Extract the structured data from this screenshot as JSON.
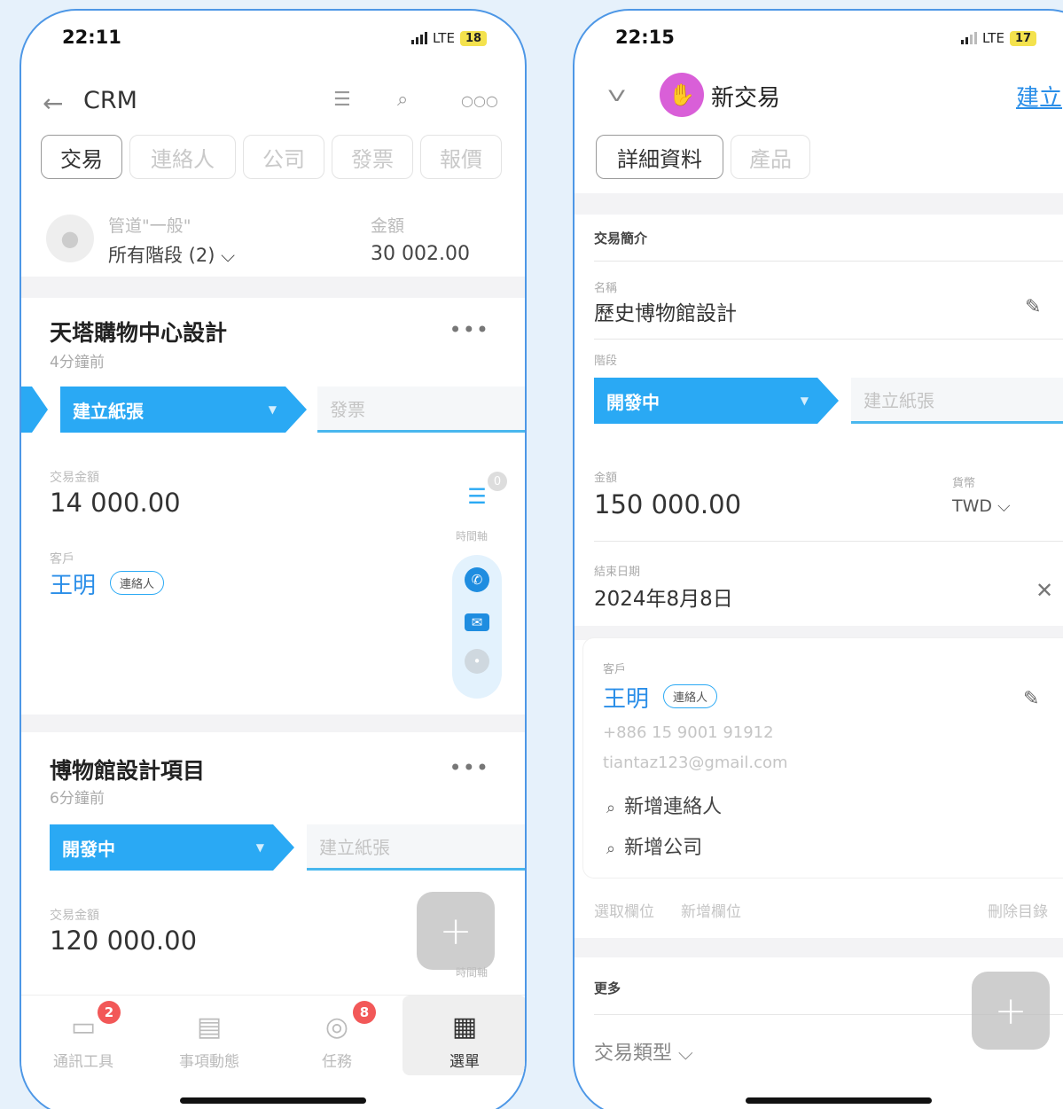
{
  "left_phone": {
    "status": {
      "time": "22:11",
      "network": "LTE",
      "battery": "18"
    },
    "header": {
      "title": "CRM"
    },
    "tabs": [
      "交易",
      "連絡人",
      "公司",
      "發票",
      "報價"
    ],
    "pipeline": {
      "label": "管道\"一般\"",
      "stage_selector": "所有階段 (2) ⌵",
      "amount_label": "金額",
      "amount_value": "30 002.00"
    },
    "deals": [
      {
        "title": "天塔購物中心設計",
        "time": "4分鐘前",
        "stage": "建立紙張",
        "next_stage": "發票",
        "amount_label": "交易金額",
        "amount": "14 000.00",
        "client_label": "客戶",
        "client_name": "王明",
        "client_badge": "連絡人"
      },
      {
        "title": "博物館設計項目",
        "time": "6分鐘前",
        "stage": "開發中",
        "next_stage": "建立紙張",
        "amount_label": "交易金額",
        "amount": "120 000.00"
      }
    ],
    "side_panel": {
      "timeline_label": "時間軸",
      "timeline_count": "0",
      "timeline_label_2": "時間軸"
    },
    "bottom_nav": [
      {
        "label": "通訊工具",
        "badge": "2",
        "icon": "chat-icon"
      },
      {
        "label": "事項動態",
        "badge": "",
        "icon": "feed-icon"
      },
      {
        "label": "任務",
        "badge": "8",
        "icon": "task-check-icon"
      },
      {
        "label": "選單",
        "badge": "",
        "icon": "grid-menu-icon"
      }
    ]
  },
  "right_phone": {
    "status": {
      "time": "22:15",
      "network": "LTE",
      "battery": "17"
    },
    "header": {
      "title": "新交易",
      "create_label": "建立"
    },
    "tabs": [
      "詳細資料",
      "產品"
    ],
    "section_title": "交易簡介",
    "name_label": "名稱",
    "name_value": "歷史博物館設計",
    "stage_label": "階段",
    "stage": "開發中",
    "next_stage": "建立紙張",
    "amount_label": "金額",
    "amount_value": "150 000.00",
    "currency_label": "貨幣",
    "currency_value": "TWD ⌵",
    "close_date_label": "結束日期",
    "close_date_value": "2024年8月8日",
    "client": {
      "label": "客戶",
      "name": "王明",
      "badge": "連絡人",
      "phone": "+886 15 9001 91912",
      "email": "tiantaz123@gmail.com",
      "add_contact": "新增連絡人",
      "add_company": "新增公司"
    },
    "footer_links": {
      "select_field": "選取欄位",
      "add_field": "新增欄位",
      "delete_item": "刪除目錄"
    },
    "more_title": "更多",
    "deal_type": "交易類型 ⌵"
  }
}
